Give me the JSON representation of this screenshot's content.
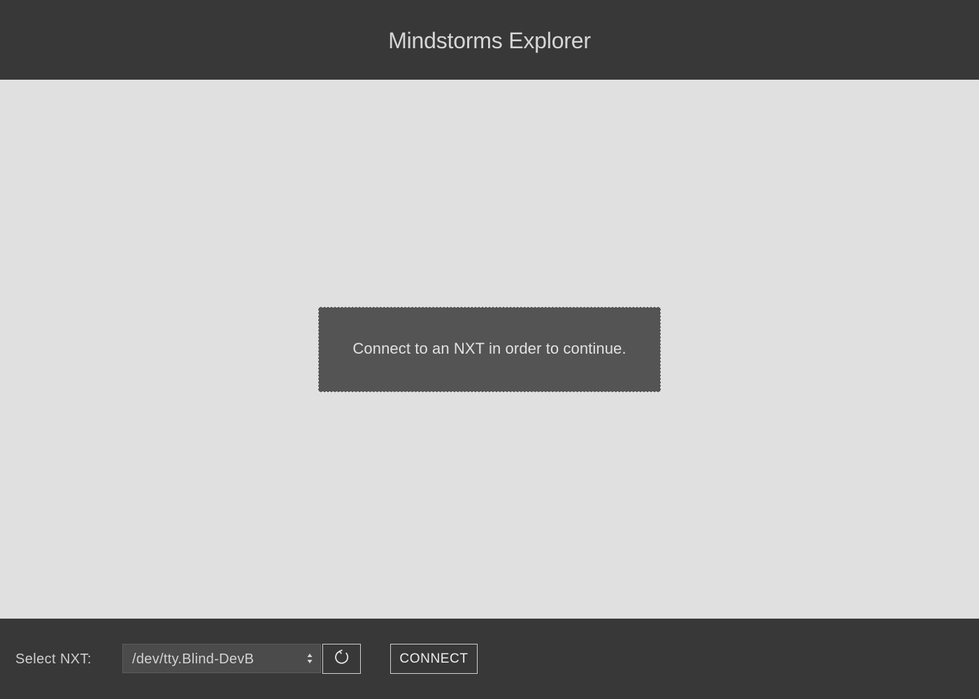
{
  "app": {
    "title": "Mindstorms Explorer"
  },
  "main": {
    "notice_text": "Connect to an NXT in order to continue."
  },
  "footer": {
    "select_label": "Select NXT:",
    "selected_device": "/dev/tty.Blind-DevB",
    "connect_label": "CONNECT"
  },
  "icons": {
    "refresh": "refresh-icon",
    "select_arrows": "updown-arrows-icon"
  },
  "colors": {
    "chrome_bg": "#383838",
    "content_bg": "#e0e0e0",
    "notice_bg": "#545454"
  }
}
